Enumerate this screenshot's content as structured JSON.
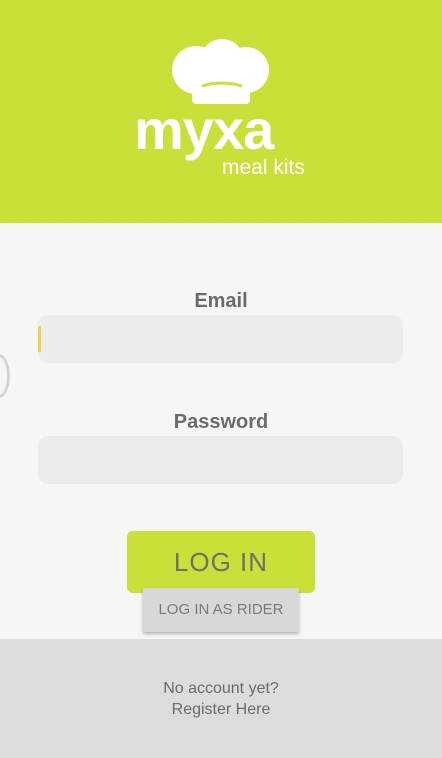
{
  "brand": {
    "name": "myxa",
    "tagline": "meal kits",
    "logo_icon": "chef-hat-icon",
    "accent_color": "#cadf37"
  },
  "form": {
    "email_label": "Email",
    "email_value": "",
    "password_label": "Password",
    "password_value": "",
    "login_label": "LOG IN",
    "rider_label": "LOG IN AS RIDER"
  },
  "footer": {
    "line1": "No account yet?",
    "line2": "Register Here"
  }
}
